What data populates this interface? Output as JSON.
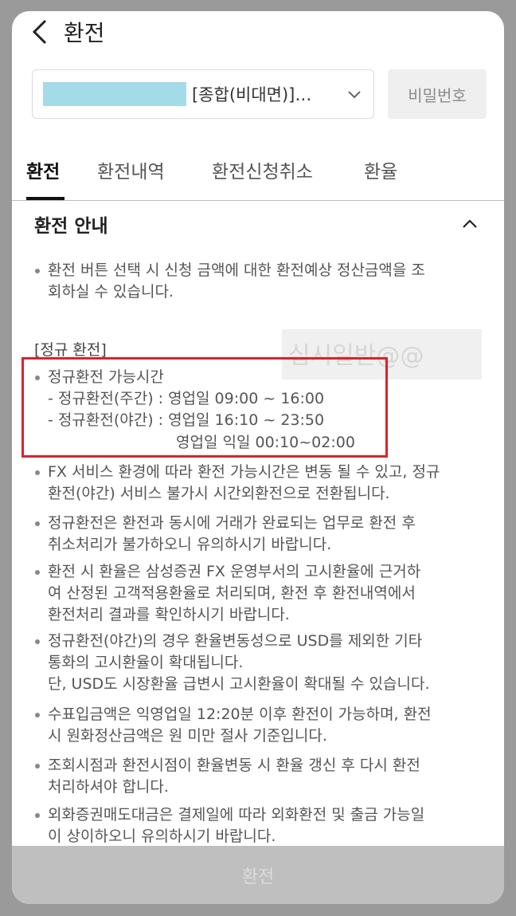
{
  "header": {
    "title": "환전",
    "back_icon": "back-arrow-icon"
  },
  "account": {
    "masked_number": "",
    "label": "[종합(비대면)]…",
    "chevron_icon": "chevron-down-icon"
  },
  "password_button": "비밀번호",
  "tabs": [
    {
      "label": "환전",
      "active": true
    },
    {
      "label": "환전내역",
      "active": false
    },
    {
      "label": "환전신청취소",
      "active": false
    },
    {
      "label": "환율",
      "active": false
    }
  ],
  "guide": {
    "title": "환전 안내",
    "collapse_icon": "chevron-up-icon",
    "intro": [
      "환전 버튼 선택 시 신청 금액에 대한 환전예상 정산금액을 조",
      "회하실 수 있습니다."
    ],
    "regular_heading": "[정규 환전]",
    "watermark": "십시일반@@",
    "hours_title": "정규환전 가능시간",
    "hours_day": "- 정규환전(주간) : 영업일 09:00 ~ 16:00",
    "hours_night": "- 정규환전(야간) : 영업일 16:10 ~ 23:50",
    "hours_night_next": "영업일 익일 00:10~02:00",
    "notes": [
      [
        "FX 서비스 환경에 따라 환전 가능시간은 변동 될 수 있고, 정규",
        "환전(야간) 서비스 불가시 시간외환전으로 전환됩니다."
      ],
      [
        "정규환전은 환전과 동시에 거래가 완료되는 업무로 환전 후",
        "취소처리가 불가하오니 유의하시기 바랍니다."
      ],
      [
        "환전 시 환율은 삼성증권 FX 운영부서의 고시환율에 근거하",
        "여 산정된 고객적용환율로 처리되며, 환전 후 환전내역에서",
        "환전처리 결과를 확인하시기 바랍니다."
      ],
      [
        "정규환전(야간)의 경우 환율변동성으로 USD를 제외한 기타",
        "통화의 고시환율이 확대됩니다.",
        "단, USD도 시장환율 급변시 고시환율이 확대될 수 있습니다."
      ],
      [
        "수표입금액은 익영업일 12:20분 이후 환전이 가능하며, 환전",
        "시 원화정산금액은 원 미만 절사 기준입니다."
      ],
      [
        "조회시점과 환전시점이 환율변동 시 환율 갱신 후 다시 환전",
        "처리하셔야 합니다."
      ],
      [
        "외화증권매도대금은 결제일에 따라 외화환전 및 출금 가능일",
        "이 상이하오니 유의하시기 바랍니다."
      ]
    ]
  },
  "submit_button": "환전",
  "colors": {
    "highlight_border": "#d9232b",
    "masked_account": "#a3dbe6",
    "disabled_button": "#bfbfbf"
  }
}
